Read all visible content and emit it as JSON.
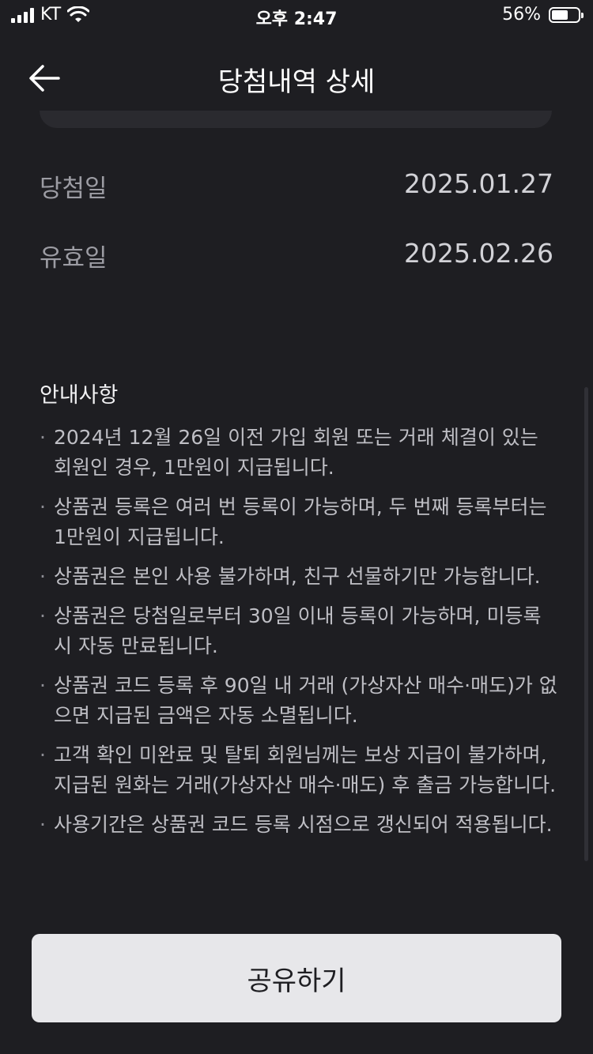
{
  "status_bar": {
    "carrier": "KT",
    "time": "오후 2:47",
    "battery": "56%"
  },
  "header": {
    "title": "당첨내역 상세"
  },
  "details": {
    "win_date_label": "당첨일",
    "win_date_value": "2025.01.27",
    "valid_date_label": "유효일",
    "valid_date_value": "2025.02.26"
  },
  "notice": {
    "title": "안내사항",
    "items": [
      "2024년 12월 26일 이전 가입 회원 또는 거래 체결이 있는 회원인 경우, 1만원이 지급됩니다.",
      "상품권 등록은 여러 번 등록이 가능하며, 두 번째 등록부터는 1만원이 지급됩니다.",
      "상품권은 본인 사용 불가하며, 친구 선물하기만 가능합니다.",
      "상품권은 당첨일로부터 30일 이내 등록이 가능하며, 미등록 시 자동 만료됩니다.",
      "상품권 코드 등록 후 90일 내 거래 (가상자산 매수·매도)가 없으면 지급된 금액은 자동 소멸됩니다.",
      "고객 확인 미완료 및 탈퇴 회원님께는 보상 지급이 불가하며, 지급된 원화는 거래(가상자산 매수·매도) 후 출금 가능합니다.",
      "사용기간은 상품권 코드 등록 시점으로 갱신되어 적용됩니다."
    ]
  },
  "share_button": {
    "label": "공유하기"
  }
}
